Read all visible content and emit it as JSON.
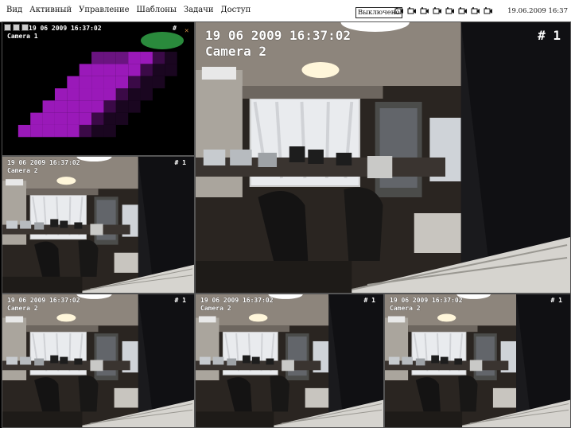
{
  "menubar": {
    "items": [
      "Вид",
      "Активный",
      "Управление",
      "Шаблоны",
      "Задачи",
      "Доступ"
    ],
    "status_button": "Выключено",
    "camera_toggle_count": 8,
    "datetime": "19.06.2009 16:37"
  },
  "tiles": {
    "tile1": {
      "timestamp": "19 06 2009 16:37:02",
      "camera": "Camera 1",
      "number": "#"
    },
    "big": {
      "timestamp": "19 06 2009 16:37:02",
      "camera": "Camera 2",
      "number": "# 1"
    },
    "left_mid": {
      "timestamp": "19 06 2009 16:37:02",
      "camera": "Camera 2",
      "number": "# 1"
    },
    "bottom1": {
      "timestamp": "19 06 2009 16:37:02",
      "camera": "Camera 2",
      "number": "# 1"
    },
    "bottom2": {
      "timestamp": "19 06 2009 16:37:02",
      "camera": "Camera 2",
      "number": "# 1"
    },
    "bottom3": {
      "timestamp": "19 06 2009 16:37:02",
      "camera": "Camera 2",
      "number": "# 1"
    }
  },
  "colors": {
    "pixelation": "#9a19b9",
    "badge": "#2a8a3c"
  }
}
